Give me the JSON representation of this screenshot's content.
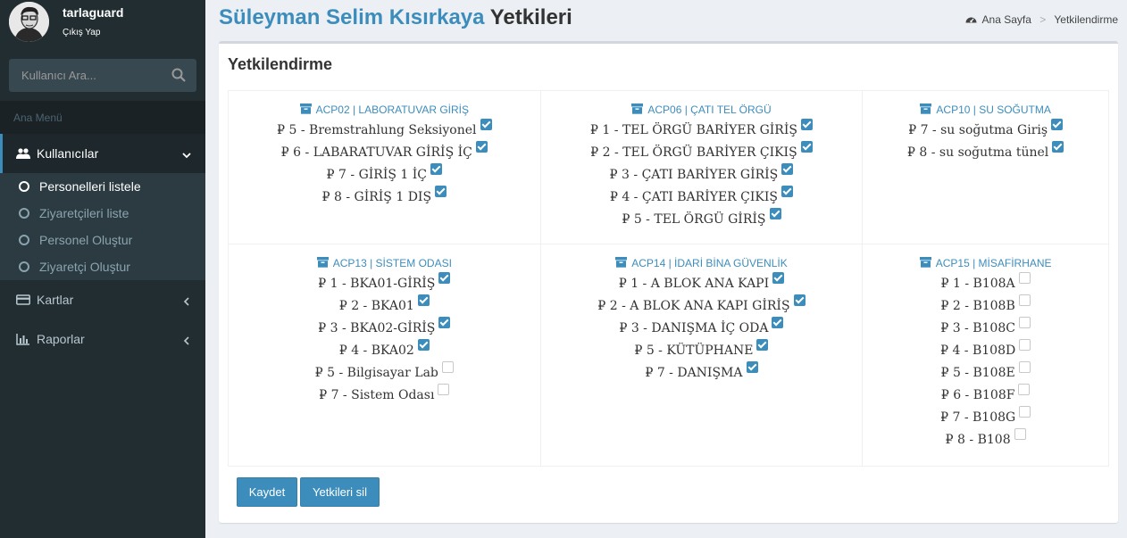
{
  "user": {
    "name": "tarlaguard",
    "logout_label": "Çıkış Yap"
  },
  "search": {
    "placeholder": "Kullanıcı Ara..."
  },
  "menu": {
    "header": "Ana Menü",
    "users": "Kullanıcılar",
    "users_sub": [
      "Personelleri listele",
      "Ziyaretçileri liste",
      "Personel Oluştur",
      "Ziyaretçi Oluştur"
    ],
    "cards": "Kartlar",
    "reports": "Raporlar"
  },
  "page": {
    "owner": "Süleyman Selim Kısırkaya",
    "title_suffix": "Yetkileri",
    "breadcrumb_home": "Ana Sayfa",
    "breadcrumb_current": "Yetkilendirme"
  },
  "box_title": "Yetkilendirme",
  "groups": [
    {
      "name": "ACP02 | LABORATUVAR GİRİŞ",
      "doors": [
        {
          "label": "5 - Bremstrahlung Seksiyonel",
          "checked": true
        },
        {
          "label": "6 - LABARATUVAR GİRİŞ İÇ",
          "checked": true
        },
        {
          "label": "7 - GİRİŞ 1 İÇ",
          "checked": true
        },
        {
          "label": "8 - GİRİŞ 1 DIŞ",
          "checked": true
        }
      ]
    },
    {
      "name": "ACP06 | ÇATI TEL ÖRGÜ",
      "doors": [
        {
          "label": "1 - TEL ÖRGÜ BARİYER GİRİŞ",
          "checked": true
        },
        {
          "label": "2 - TEL ÖRGÜ BARİYER ÇIKIŞ",
          "checked": true
        },
        {
          "label": "3 - ÇATI BARİYER GİRİŞ",
          "checked": true
        },
        {
          "label": "4 - ÇATI BARİYER ÇIKIŞ",
          "checked": true
        },
        {
          "label": "5 - TEL ÖRGÜ GİRİŞ",
          "checked": true
        }
      ]
    },
    {
      "name": "ACP10 | SU SOĞUTMA",
      "doors": [
        {
          "label": "7 - su soğutma Giriş",
          "checked": true
        },
        {
          "label": "8 - su soğutma tünel",
          "checked": true
        }
      ]
    },
    {
      "name": "ACP13 | SİSTEM ODASI",
      "doors": [
        {
          "label": "1 - BKA01-GİRİŞ",
          "checked": true
        },
        {
          "label": "2 - BKA01",
          "checked": true
        },
        {
          "label": "3 - BKA02-GİRİŞ",
          "checked": true
        },
        {
          "label": "4 - BKA02",
          "checked": true
        },
        {
          "label": "5 - Bilgisayar Lab",
          "checked": false
        },
        {
          "label": "7 - Sistem Odası",
          "checked": false
        }
      ]
    },
    {
      "name": "ACP14 | İDARİ BİNA GÜVENLİK",
      "doors": [
        {
          "label": "1 - A BLOK ANA KAPI",
          "checked": true
        },
        {
          "label": "2 - A BLOK ANA KAPI GİRİŞ",
          "checked": true
        },
        {
          "label": "3 - DANIŞMA İÇ ODA",
          "checked": true
        },
        {
          "label": "5 - KÜTÜPHANE",
          "checked": true
        },
        {
          "label": "7 - DANIŞMA",
          "checked": true
        }
      ]
    },
    {
      "name": "ACP15 | MİSAFİRHANE",
      "doors": [
        {
          "label": "1 - B108A",
          "checked": false
        },
        {
          "label": "2 - B108B",
          "checked": false
        },
        {
          "label": "3 - B108C",
          "checked": false
        },
        {
          "label": "4 - B108D",
          "checked": false
        },
        {
          "label": "5 - B108E",
          "checked": false
        },
        {
          "label": "6 - B108F",
          "checked": false
        },
        {
          "label": "7 - B108G",
          "checked": false
        },
        {
          "label": "8 - B108",
          "checked": false
        }
      ]
    }
  ],
  "door_icon": "₽",
  "buttons": {
    "save": "Kaydet",
    "delete": "Yetkileri sil"
  },
  "colors": {
    "accent": "#3c8dbc",
    "sidebar": "#222d32",
    "background": "#ecf0f5"
  }
}
